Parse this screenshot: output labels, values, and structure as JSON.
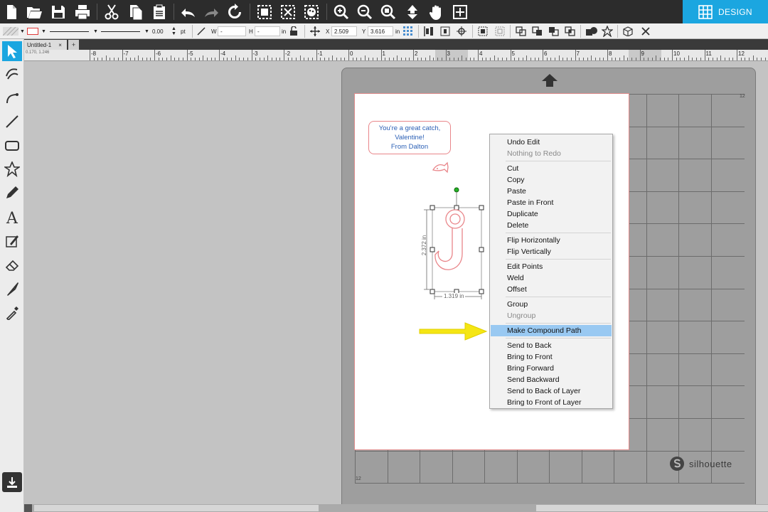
{
  "toolbar": {
    "design_label": "DESIGN",
    "icons": [
      "new-document-icon",
      "open-folder-icon",
      "save-icon",
      "print-icon",
      "cut-icon",
      "copy-icon",
      "paste-icon",
      "undo-icon",
      "redo-icon",
      "redraw-icon",
      "select-all-icon",
      "deselect-icon",
      "palette-icon",
      "zoom-in-icon",
      "zoom-out-icon",
      "zoom-select-icon",
      "move-icon",
      "pan-hand-icon",
      "fit-page-icon"
    ]
  },
  "propbar": {
    "line_width": "0.00",
    "line_unit": "pt",
    "w_label": "W",
    "w_value": "-",
    "h_label": "H",
    "h_value": "-",
    "wh_unit": "in",
    "x_label": "X",
    "x_value": "2.509",
    "y_label": "Y",
    "y_value": "3.616",
    "xy_unit": "in"
  },
  "tabs": {
    "document_tab": "Untitled-1",
    "close": "×",
    "add": "+"
  },
  "ruler": {
    "corner": "0.170, 1.246",
    "labels": [
      "-8",
      "-7",
      "-6",
      "-5",
      "-4",
      "-3",
      "-2",
      "-1",
      "0",
      "1",
      "2",
      "3",
      "4",
      "5",
      "6",
      "7",
      "8",
      "9",
      "10",
      "11",
      "12"
    ]
  },
  "canvas": {
    "text_lines": [
      "You're a great catch,",
      "Valentine!",
      "From Dalton"
    ],
    "height_dim": "2.372 in",
    "width_dim": "1.319 in",
    "mat_corner_top": "12",
    "mat_corner_bottom": "12",
    "brand": "silhouette",
    "accent_color": "#1ba6e0",
    "highlight_color": "#99c9f2",
    "arrow_color": "#f5e614"
  },
  "context_menu": {
    "groups": [
      [
        {
          "label": "Undo Edit",
          "enabled": true
        },
        {
          "label": "Nothing to Redo",
          "enabled": false
        }
      ],
      [
        {
          "label": "Cut",
          "enabled": true
        },
        {
          "label": "Copy",
          "enabled": true
        },
        {
          "label": "Paste",
          "enabled": true
        },
        {
          "label": "Paste in Front",
          "enabled": true
        },
        {
          "label": "Duplicate",
          "enabled": true
        },
        {
          "label": "Delete",
          "enabled": true
        }
      ],
      [
        {
          "label": "Flip Horizontally",
          "enabled": true
        },
        {
          "label": "Flip Vertically",
          "enabled": true
        }
      ],
      [
        {
          "label": "Edit Points",
          "enabled": true
        },
        {
          "label": "Weld",
          "enabled": true
        },
        {
          "label": "Offset",
          "enabled": true
        }
      ],
      [
        {
          "label": "Group",
          "enabled": true
        },
        {
          "label": "Ungroup",
          "enabled": false
        }
      ],
      [
        {
          "label": "Make Compound Path",
          "enabled": true,
          "highlighted": true
        }
      ],
      [
        {
          "label": "Send to Back",
          "enabled": true
        },
        {
          "label": "Bring to Front",
          "enabled": true
        },
        {
          "label": "Bring Forward",
          "enabled": true
        },
        {
          "label": "Send Backward",
          "enabled": true
        },
        {
          "label": "Send to Back of Layer",
          "enabled": true
        },
        {
          "label": "Bring to Front of Layer",
          "enabled": true
        }
      ]
    ]
  }
}
